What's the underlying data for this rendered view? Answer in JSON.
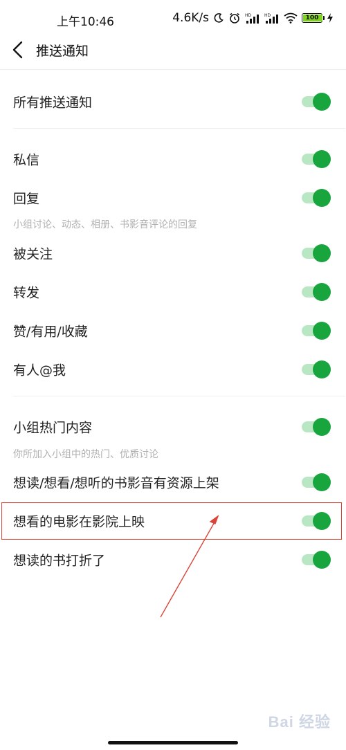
{
  "status_bar": {
    "time": "上午10:46",
    "net_speed": "4.6K/s",
    "battery_level": "100",
    "battery_fraction": 1.0
  },
  "header": {
    "title": "推送通知",
    "back_icon": "chevron-left-icon"
  },
  "settings": {
    "all_push": {
      "label": "所有推送通知",
      "enabled": true
    },
    "private_message": {
      "label": "私信",
      "enabled": true
    },
    "reply": {
      "label": "回复",
      "hint": "小组讨论、动态、相册、书影音评论的回复",
      "enabled": true
    },
    "followed": {
      "label": "被关注",
      "enabled": true
    },
    "forward": {
      "label": "转发",
      "enabled": true
    },
    "like": {
      "label": "赞/有用/收藏",
      "enabled": true
    },
    "mention": {
      "label": "有人@我",
      "enabled": true
    },
    "group_hot": {
      "label": "小组热门内容",
      "hint": "你所加入小组中的热门、优质讨论",
      "enabled": true
    },
    "want_resources": {
      "label": "想读/想看/想听的书影音有资源上架",
      "enabled": true
    },
    "movie_showing": {
      "label": "想看的电影在影院上映",
      "enabled": true
    },
    "book_discount": {
      "label": "想读的书打折了",
      "enabled": true
    }
  },
  "colors": {
    "toggle_on": "#19a53e",
    "toggle_track": "#b9e7c3",
    "highlight": "#d9453a"
  },
  "watermark": {
    "text": "Bai 经验"
  }
}
